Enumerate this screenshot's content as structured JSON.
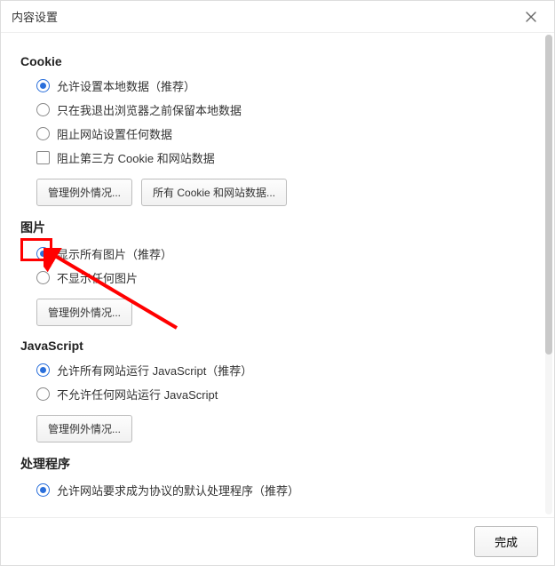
{
  "dialog": {
    "title": "内容设置"
  },
  "sections": {
    "cookie": {
      "heading": "Cookie",
      "opts": [
        "允许设置本地数据（推荐）",
        "只在我退出浏览器之前保留本地数据",
        "阻止网站设置任何数据"
      ],
      "checkbox": "阻止第三方 Cookie 和网站数据",
      "btn_manage": "管理例外情况...",
      "btn_all": "所有 Cookie 和网站数据..."
    },
    "images": {
      "heading": "图片",
      "opts": [
        "显示所有图片（推荐）",
        "不显示任何图片"
      ],
      "btn_manage": "管理例外情况..."
    },
    "javascript": {
      "heading": "JavaScript",
      "opts": [
        "允许所有网站运行 JavaScript（推荐）",
        "不允许任何网站运行 JavaScript"
      ],
      "btn_manage": "管理例外情况..."
    },
    "handlers": {
      "heading": "处理程序",
      "opts": [
        "允许网站要求成为协议的默认处理程序（推荐）"
      ]
    }
  },
  "footer": {
    "done": "完成"
  },
  "annotation": {
    "highlight_target": "images-option-show-all"
  }
}
